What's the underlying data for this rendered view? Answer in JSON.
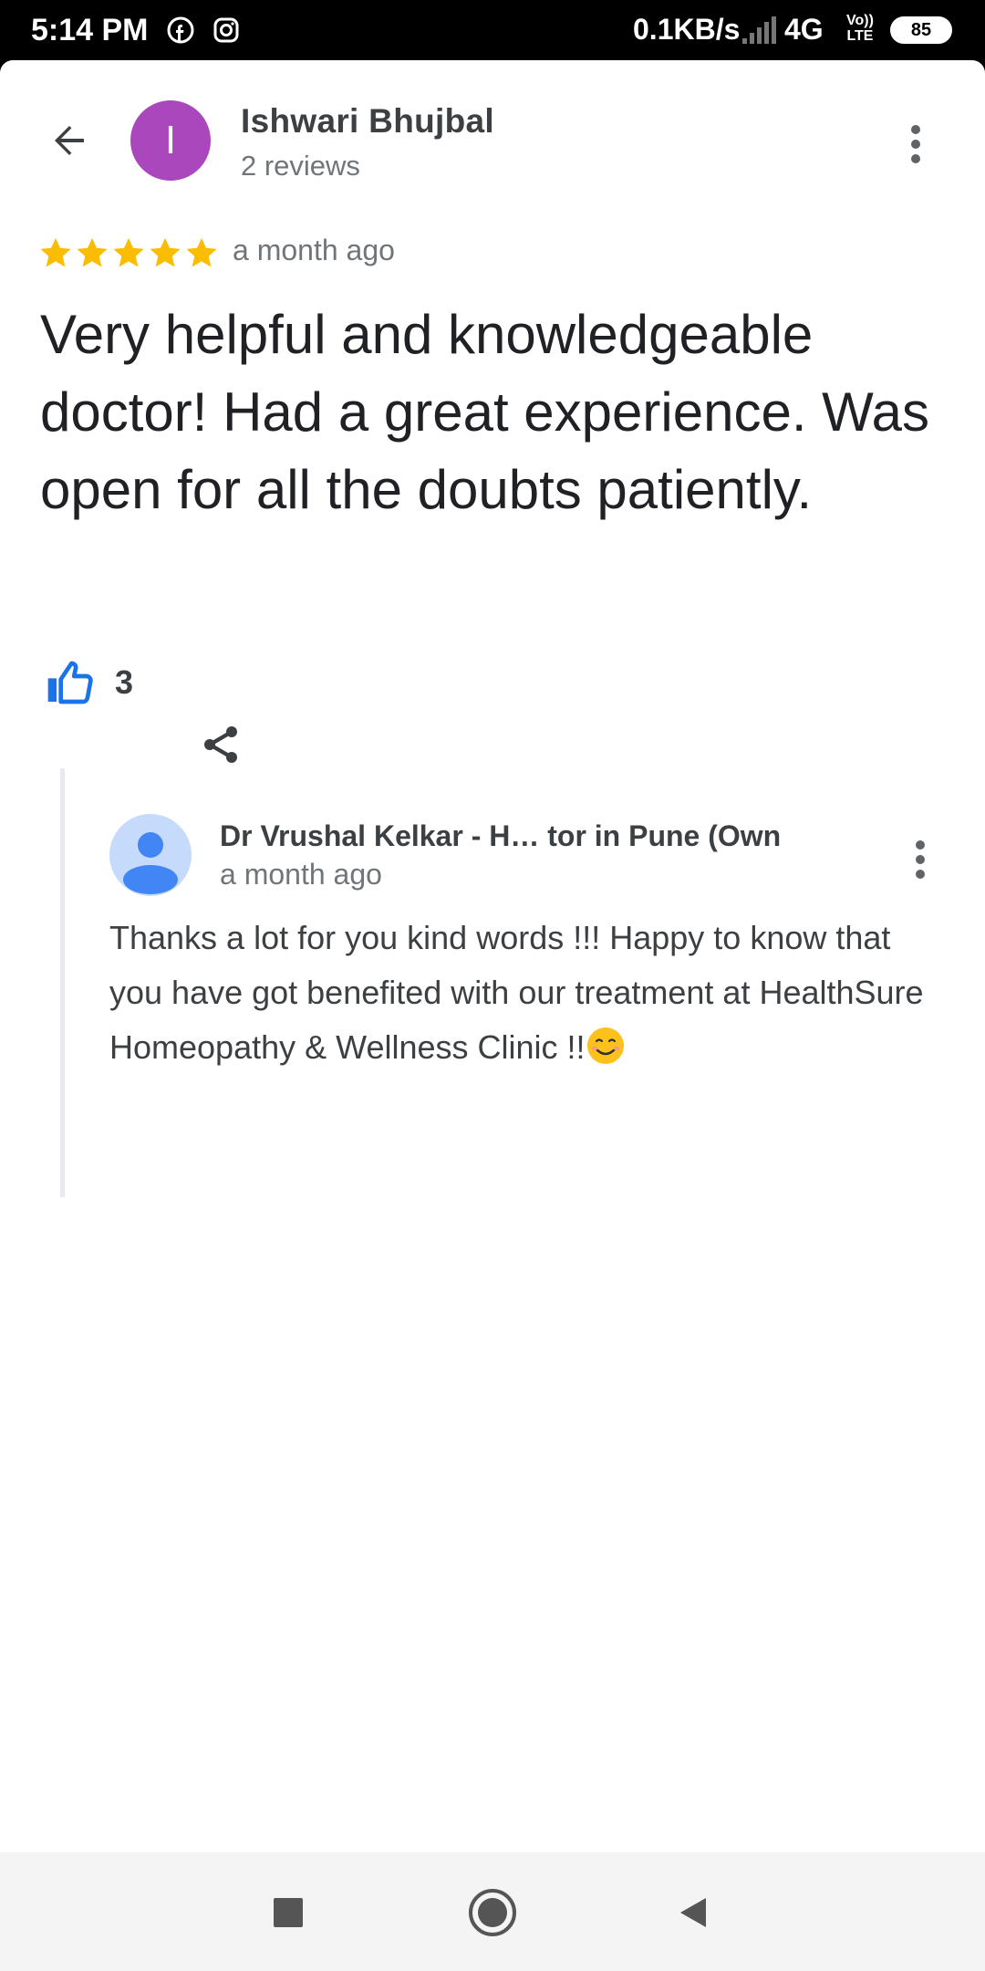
{
  "status_bar": {
    "time": "5:14 PM",
    "network_speed": "0.1KB/s",
    "network_type": "4G",
    "volte_top": "Vo))",
    "volte_bottom": "LTE",
    "battery": "85",
    "icons": [
      "facebook-icon",
      "instagram-icon",
      "signal-icon",
      "battery-icon"
    ]
  },
  "header": {
    "avatar_letter": "I",
    "reviewer_name": "Ishwari Bhujbal",
    "review_count": "2 reviews",
    "avatar_color": "#ab47bc"
  },
  "review": {
    "rating": 5,
    "time": "a month ago",
    "text": "Very helpful and knowledgeable doctor! Had a great experience. Was open for all the doubts patiently.",
    "likes": "3",
    "star_color": "#fbbc04",
    "like_color": "#1a73e8"
  },
  "reply": {
    "name": "Dr Vrushal Kelkar - H…      tor in Pune (Own",
    "time": "a month ago",
    "text": "Thanks a lot for you kind words !!! Happy to know that you have got benefited with our treatment at HealthSure Homeopathy & Wellness Clinic !!"
  },
  "nav_bar": {
    "buttons": [
      "recents-button",
      "home-button",
      "back-button"
    ]
  }
}
